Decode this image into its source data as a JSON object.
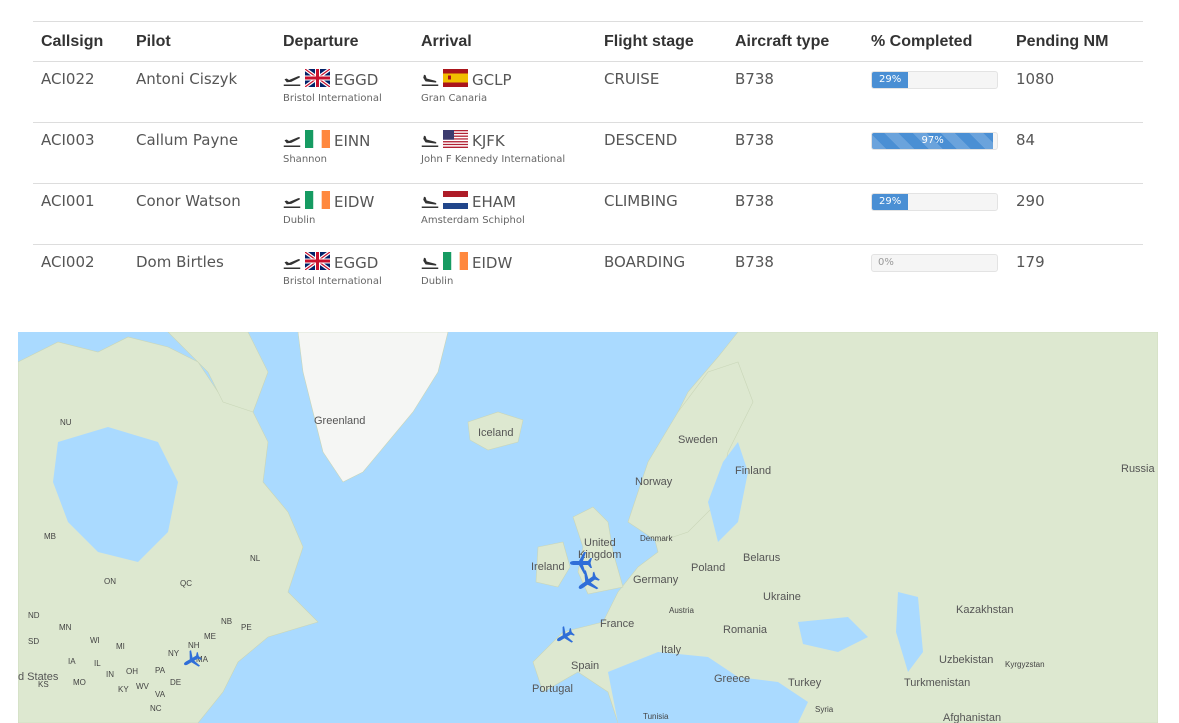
{
  "table": {
    "headers": [
      "Callsign",
      "Pilot",
      "Departure",
      "Arrival",
      "Flight stage",
      "Aircraft type",
      "% Completed",
      "Pending NM"
    ],
    "rows": [
      {
        "callsign": "ACI022",
        "pilot": "Antoni Ciszyk",
        "dep_code": "EGGD",
        "dep_name": "Bristol International",
        "dep_flag": "uk",
        "arr_code": "GCLP",
        "arr_name": "Gran Canaria",
        "arr_flag": "es",
        "stage": "CRUISE",
        "aircraft": "B738",
        "percent": 29,
        "percent_label": "29%",
        "pending": "1080"
      },
      {
        "callsign": "ACI003",
        "pilot": "Callum Payne",
        "dep_code": "EINN",
        "dep_name": "Shannon",
        "dep_flag": "ie",
        "arr_code": "KJFK",
        "arr_name": "John F Kennedy International",
        "arr_flag": "us",
        "stage": "DESCEND",
        "aircraft": "B738",
        "percent": 97,
        "percent_label": "97%",
        "pending": "84"
      },
      {
        "callsign": "ACI001",
        "pilot": "Conor Watson",
        "dep_code": "EIDW",
        "dep_name": "Dublin",
        "dep_flag": "ie",
        "arr_code": "EHAM",
        "arr_name": "Amsterdam Schiphol",
        "arr_flag": "nl",
        "stage": "CLIMBING",
        "aircraft": "B738",
        "percent": 29,
        "percent_label": "29%",
        "pending": "290"
      },
      {
        "callsign": "ACI002",
        "pilot": "Dom Birtles",
        "dep_code": "EGGD",
        "dep_name": "Bristol International",
        "dep_flag": "uk",
        "arr_code": "EIDW",
        "arr_name": "Dublin",
        "arr_flag": "ie",
        "stage": "BOARDING",
        "aircraft": "B738",
        "percent": 0,
        "percent_label": "0%",
        "pending": "179"
      }
    ]
  },
  "map": {
    "labels": {
      "greenland": "Greenland",
      "iceland": "Iceland",
      "sweden": "Sweden",
      "finland": "Finland",
      "norway": "Norway",
      "russia": "Russia",
      "denmark": "Denmark",
      "united": "United",
      "kingdom": "Kingdom",
      "ireland": "Ireland",
      "belarus": "Belarus",
      "poland": "Poland",
      "germany": "Germany",
      "ukraine": "Ukraine",
      "kazakhstan": "Kazakhstan",
      "austria": "Austria",
      "france": "France",
      "romania": "Romania",
      "spain": "Spain",
      "italy": "Italy",
      "uzbekistan": "Uzbekistan",
      "kyrgyzstan": "Kyrgyzstan",
      "portugal": "Portugal",
      "greece": "Greece",
      "turkey": "Turkey",
      "turkmenistan": "Turkmenistan",
      "tunisia": "Tunisia",
      "syria": "Syria",
      "afghanistan": "Afghanistan",
      "nu": "NU",
      "mb": "MB",
      "on": "ON",
      "qc": "QC",
      "nl": "NL",
      "nd": "ND",
      "mn": "MN",
      "sd": "SD",
      "wi": "WI",
      "mi": "MI",
      "me": "ME",
      "nb": "NB",
      "pe": "PE",
      "ia": "IA",
      "il": "IL",
      "ny": "NY",
      "nh": "NH",
      "ma": "MA",
      "pa": "PA",
      "oh": "OH",
      "in": "IN",
      "de": "DE",
      "ks": "KS",
      "mo": "MO",
      "ky": "KY",
      "wv": "WV",
      "va": "VA",
      "nc": "NC",
      "states": "d States"
    }
  }
}
